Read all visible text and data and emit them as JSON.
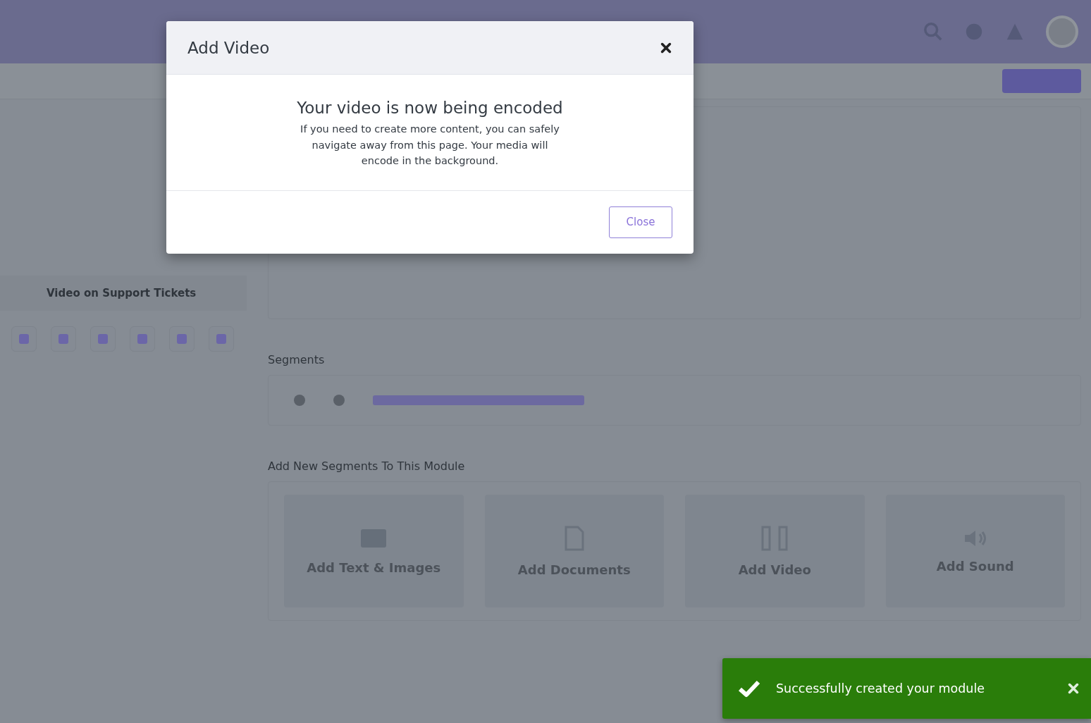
{
  "background": {
    "sidebar_items": [
      {
        "label": "Video on Support Tickets"
      }
    ],
    "segments_heading": "Segments",
    "add_heading": "Add New Segments To This Module",
    "add_cards": [
      {
        "kind": "text",
        "label": "Add Text & Images"
      },
      {
        "kind": "document",
        "label": "Add Documents"
      },
      {
        "kind": "video",
        "label": "Add Video"
      },
      {
        "kind": "sound",
        "label": "Add Sound"
      }
    ]
  },
  "modal": {
    "title": "Add Video",
    "heading": "Your video is now being encoded",
    "message": "If you need to create more content, you can safely navigate away from this page. Your media will encode in the background.",
    "close_button": "Close"
  },
  "toast": {
    "message": "Successfully created your module"
  }
}
